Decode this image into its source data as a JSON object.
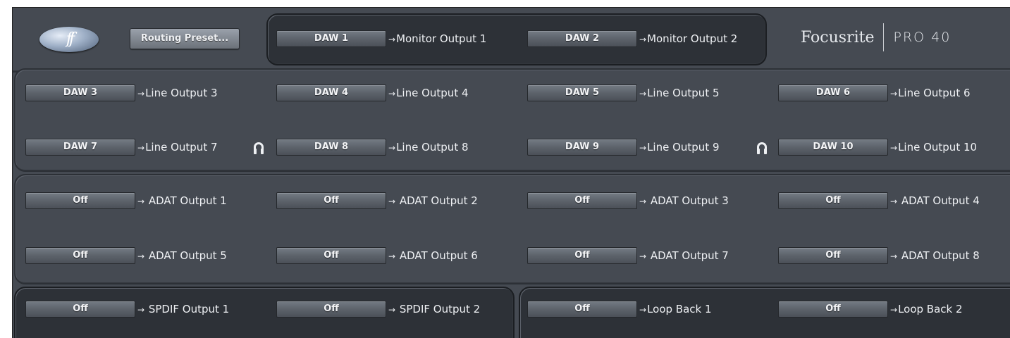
{
  "header": {
    "logo_text": "ff",
    "preset_button": "Routing Preset...",
    "brand_name": "Focusrite",
    "model": "PRO 40"
  },
  "monitor_routes": [
    {
      "source": "DAW 1",
      "arrow": "→",
      "output": "Monitor Output 1"
    },
    {
      "source": "DAW 2",
      "arrow": "→",
      "output": "Monitor Output 2"
    }
  ],
  "line_routes": [
    {
      "source": "DAW 3",
      "arrow": "→",
      "output": "Line Output 3"
    },
    {
      "source": "DAW 4",
      "arrow": "→",
      "output": "Line Output 4"
    },
    {
      "source": "DAW 5",
      "arrow": "→",
      "output": "Line Output 5"
    },
    {
      "source": "DAW 6",
      "arrow": "→",
      "output": "Line Output 6"
    },
    {
      "source": "DAW 7",
      "arrow": "→",
      "output": "Line Output 7"
    },
    {
      "source": "DAW 8",
      "arrow": "→",
      "output": "Line Output 8"
    },
    {
      "source": "DAW 9",
      "arrow": "→",
      "output": "Line Output 9"
    },
    {
      "source": "DAW 10",
      "arrow": "→",
      "output": "Line Output 10"
    }
  ],
  "adat_routes": [
    {
      "source": "Off",
      "arrow": "→",
      "output": "ADAT Output 1"
    },
    {
      "source": "Off",
      "arrow": "→",
      "output": "ADAT Output 2"
    },
    {
      "source": "Off",
      "arrow": "→",
      "output": "ADAT Output 3"
    },
    {
      "source": "Off",
      "arrow": "→",
      "output": "ADAT Output 4"
    },
    {
      "source": "Off",
      "arrow": "→",
      "output": "ADAT Output 5"
    },
    {
      "source": "Off",
      "arrow": "→",
      "output": "ADAT Output 6"
    },
    {
      "source": "Off",
      "arrow": "→",
      "output": "ADAT Output 7"
    },
    {
      "source": "Off",
      "arrow": "→",
      "output": "ADAT Output 8"
    }
  ],
  "spdif_routes": [
    {
      "source": "Off",
      "arrow": "→",
      "output": "SPDIF Output 1"
    },
    {
      "source": "Off",
      "arrow": "→",
      "output": "SPDIF Output 2"
    }
  ],
  "loop_routes": [
    {
      "source": "Off",
      "arrow": "→",
      "output": "Loop Back 1"
    },
    {
      "source": "Off",
      "arrow": "→",
      "output": "Loop Back 2"
    }
  ],
  "icons": {
    "headphone_icon": "headphone-icon"
  },
  "colors": {
    "panel": "#454a52",
    "dark_panel": "#2d3137",
    "text": "#eef0f3"
  }
}
